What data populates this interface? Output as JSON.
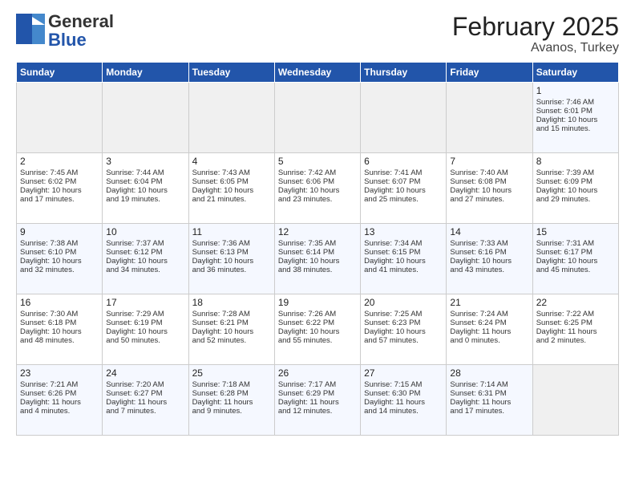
{
  "header": {
    "logo_general": "General",
    "logo_blue": "Blue",
    "month": "February 2025",
    "location": "Avanos, Turkey"
  },
  "days_of_week": [
    "Sunday",
    "Monday",
    "Tuesday",
    "Wednesday",
    "Thursday",
    "Friday",
    "Saturday"
  ],
  "weeks": [
    [
      {
        "day": "",
        "info": ""
      },
      {
        "day": "",
        "info": ""
      },
      {
        "day": "",
        "info": ""
      },
      {
        "day": "",
        "info": ""
      },
      {
        "day": "",
        "info": ""
      },
      {
        "day": "",
        "info": ""
      },
      {
        "day": "1",
        "info": "Sunrise: 7:46 AM\nSunset: 6:01 PM\nDaylight: 10 hours\nand 15 minutes."
      }
    ],
    [
      {
        "day": "2",
        "info": "Sunrise: 7:45 AM\nSunset: 6:02 PM\nDaylight: 10 hours\nand 17 minutes."
      },
      {
        "day": "3",
        "info": "Sunrise: 7:44 AM\nSunset: 6:04 PM\nDaylight: 10 hours\nand 19 minutes."
      },
      {
        "day": "4",
        "info": "Sunrise: 7:43 AM\nSunset: 6:05 PM\nDaylight: 10 hours\nand 21 minutes."
      },
      {
        "day": "5",
        "info": "Sunrise: 7:42 AM\nSunset: 6:06 PM\nDaylight: 10 hours\nand 23 minutes."
      },
      {
        "day": "6",
        "info": "Sunrise: 7:41 AM\nSunset: 6:07 PM\nDaylight: 10 hours\nand 25 minutes."
      },
      {
        "day": "7",
        "info": "Sunrise: 7:40 AM\nSunset: 6:08 PM\nDaylight: 10 hours\nand 27 minutes."
      },
      {
        "day": "8",
        "info": "Sunrise: 7:39 AM\nSunset: 6:09 PM\nDaylight: 10 hours\nand 29 minutes."
      }
    ],
    [
      {
        "day": "9",
        "info": "Sunrise: 7:38 AM\nSunset: 6:10 PM\nDaylight: 10 hours\nand 32 minutes."
      },
      {
        "day": "10",
        "info": "Sunrise: 7:37 AM\nSunset: 6:12 PM\nDaylight: 10 hours\nand 34 minutes."
      },
      {
        "day": "11",
        "info": "Sunrise: 7:36 AM\nSunset: 6:13 PM\nDaylight: 10 hours\nand 36 minutes."
      },
      {
        "day": "12",
        "info": "Sunrise: 7:35 AM\nSunset: 6:14 PM\nDaylight: 10 hours\nand 38 minutes."
      },
      {
        "day": "13",
        "info": "Sunrise: 7:34 AM\nSunset: 6:15 PM\nDaylight: 10 hours\nand 41 minutes."
      },
      {
        "day": "14",
        "info": "Sunrise: 7:33 AM\nSunset: 6:16 PM\nDaylight: 10 hours\nand 43 minutes."
      },
      {
        "day": "15",
        "info": "Sunrise: 7:31 AM\nSunset: 6:17 PM\nDaylight: 10 hours\nand 45 minutes."
      }
    ],
    [
      {
        "day": "16",
        "info": "Sunrise: 7:30 AM\nSunset: 6:18 PM\nDaylight: 10 hours\nand 48 minutes."
      },
      {
        "day": "17",
        "info": "Sunrise: 7:29 AM\nSunset: 6:19 PM\nDaylight: 10 hours\nand 50 minutes."
      },
      {
        "day": "18",
        "info": "Sunrise: 7:28 AM\nSunset: 6:21 PM\nDaylight: 10 hours\nand 52 minutes."
      },
      {
        "day": "19",
        "info": "Sunrise: 7:26 AM\nSunset: 6:22 PM\nDaylight: 10 hours\nand 55 minutes."
      },
      {
        "day": "20",
        "info": "Sunrise: 7:25 AM\nSunset: 6:23 PM\nDaylight: 10 hours\nand 57 minutes."
      },
      {
        "day": "21",
        "info": "Sunrise: 7:24 AM\nSunset: 6:24 PM\nDaylight: 11 hours\nand 0 minutes."
      },
      {
        "day": "22",
        "info": "Sunrise: 7:22 AM\nSunset: 6:25 PM\nDaylight: 11 hours\nand 2 minutes."
      }
    ],
    [
      {
        "day": "23",
        "info": "Sunrise: 7:21 AM\nSunset: 6:26 PM\nDaylight: 11 hours\nand 4 minutes."
      },
      {
        "day": "24",
        "info": "Sunrise: 7:20 AM\nSunset: 6:27 PM\nDaylight: 11 hours\nand 7 minutes."
      },
      {
        "day": "25",
        "info": "Sunrise: 7:18 AM\nSunset: 6:28 PM\nDaylight: 11 hours\nand 9 minutes."
      },
      {
        "day": "26",
        "info": "Sunrise: 7:17 AM\nSunset: 6:29 PM\nDaylight: 11 hours\nand 12 minutes."
      },
      {
        "day": "27",
        "info": "Sunrise: 7:15 AM\nSunset: 6:30 PM\nDaylight: 11 hours\nand 14 minutes."
      },
      {
        "day": "28",
        "info": "Sunrise: 7:14 AM\nSunset: 6:31 PM\nDaylight: 11 hours\nand 17 minutes."
      },
      {
        "day": "",
        "info": ""
      }
    ]
  ]
}
